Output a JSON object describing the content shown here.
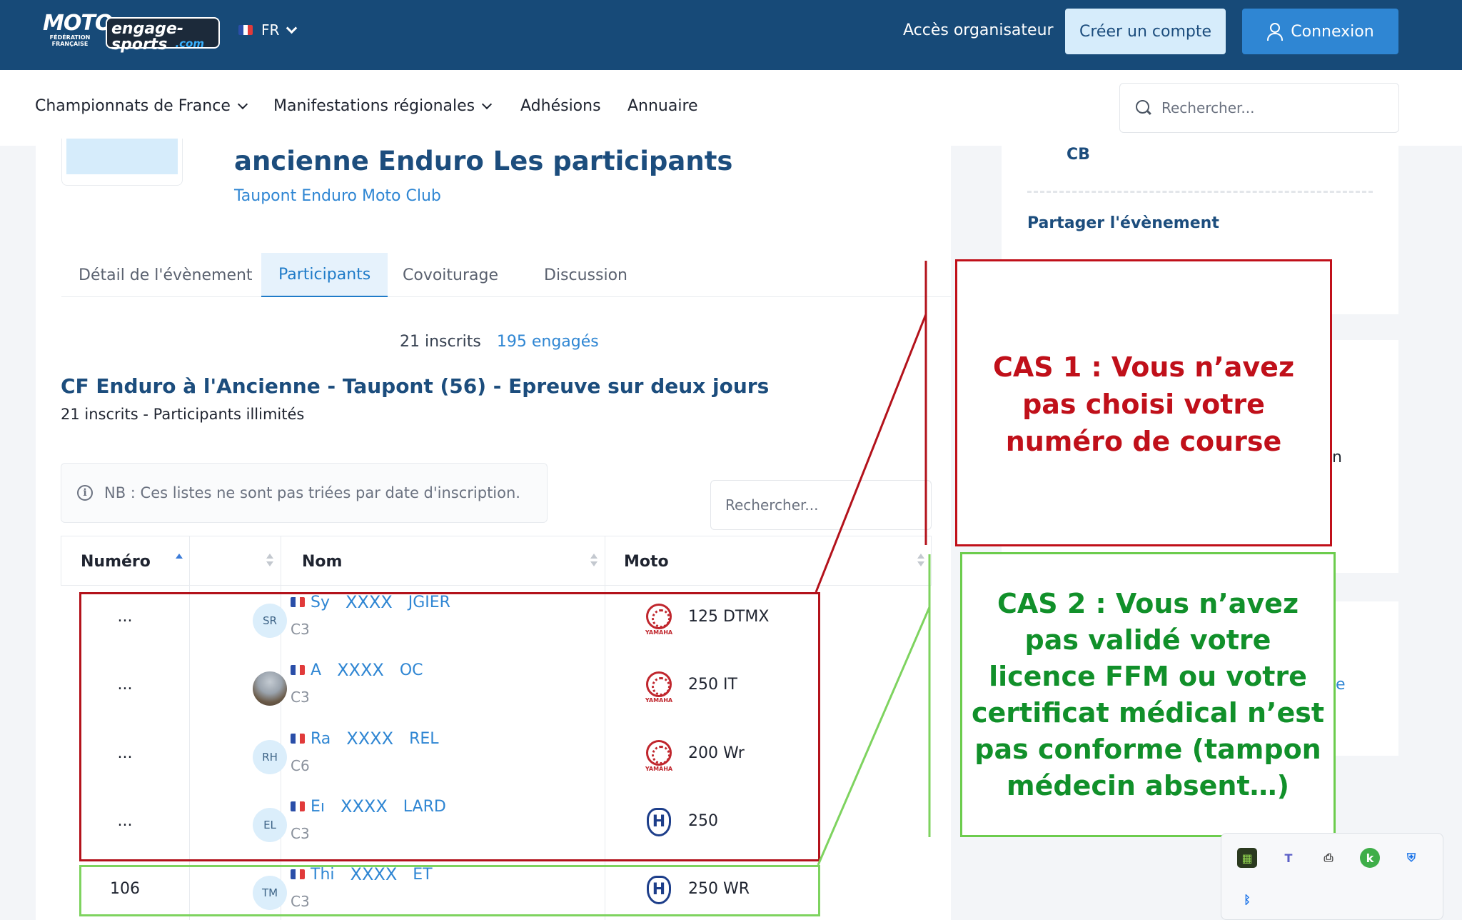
{
  "header": {
    "logo_ffm": "MOTO",
    "logo_ffm_sub": "FÉDÉRATION FRANÇAISE",
    "logo_es": "engage-sports",
    "logo_es_com": ".com",
    "language": "FR",
    "organizer_link": "Accès organisateur",
    "create_account": "Créer un compte",
    "login": "Connexion"
  },
  "nav": {
    "items": [
      "Championnats de France",
      "Manifestations régionales",
      "Adhésions",
      "Annuaire"
    ],
    "search_placeholder": "Rechercher..."
  },
  "event": {
    "title": "ancienne Enduro Les participants",
    "club": "Taupont Enduro Moto Club",
    "tabs": [
      "Détail de l'évènement",
      "Participants",
      "Covoiturage",
      "Discussion"
    ],
    "active_tab": "Participants",
    "registered_count": "21 inscrits",
    "engaged_count": "195 engagés",
    "race_title": "CF Enduro à l'Ancienne - Taupont (56) - Epreuve sur deux jours",
    "race_subtitle": "21 inscrits - Participants illimités",
    "notice": "NB : Ces listes ne sont pas triées par date d'inscription.",
    "table_search_placeholder": "Rechercher..."
  },
  "table": {
    "headers": [
      "Numéro",
      "",
      "Nom",
      "Moto"
    ],
    "rows": [
      {
        "num": "...",
        "initials": "SR",
        "first": "Sy",
        "mask": "XXXX",
        "last": "JGIER",
        "cat": "C3",
        "brand": "yamaha",
        "moto": "125 DTMX"
      },
      {
        "num": "...",
        "initials": "",
        "first": "A",
        "mask": "XXXX",
        "last": "OC",
        "cat": "C3",
        "brand": "yamaha",
        "moto": "250 IT"
      },
      {
        "num": "...",
        "initials": "RH",
        "first": "Ra",
        "mask": "XXXX",
        "last": "REL",
        "cat": "C6",
        "brand": "yamaha",
        "moto": "200 Wr"
      },
      {
        "num": "...",
        "initials": "EL",
        "first": "Eı",
        "mask": "XXXX",
        "last": "LARD",
        "cat": "C3",
        "brand": "husqvarna",
        "moto": "250"
      },
      {
        "num": "106",
        "initials": "TM",
        "first": "Thi",
        "mask": "XXXX",
        "last": "ET",
        "cat": "C3",
        "brand": "husqvarna",
        "moto": "250 WR"
      }
    ],
    "yamaha_label": "YAMAHA",
    "husqvarna_letter": "H"
  },
  "sidebar": {
    "payment": "CB",
    "share_title": "Partager l'évènement",
    "fragment1": "n",
    "fragment2": "e"
  },
  "annotations": {
    "cas1": "CAS 1 : Vous n’avez pas choisi votre numéro de course",
    "cas2": "CAS 2 : Vous n’avez pas validé votre licence FFM ou votre certificat médical n’est pas conforme (tampon médecin absent…)"
  },
  "colors": {
    "topbar": "#174a78",
    "accent": "#2f86d3",
    "cas1": "#c0101a",
    "cas2": "#11902a"
  }
}
